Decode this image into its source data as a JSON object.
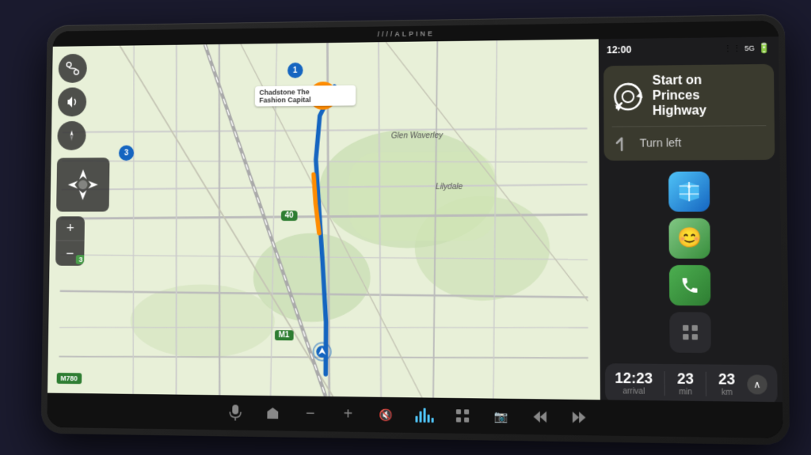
{
  "device": {
    "brand": "////ALPINE"
  },
  "status_bar": {
    "time": "12:00",
    "network": "5G",
    "battery_icon": "🔋"
  },
  "nav_card": {
    "main_instruction": "Start on\nPrinces\nHighway",
    "secondary_instruction": "Turn left"
  },
  "eta": {
    "arrival_time": "12:23",
    "arrival_label": "arrival",
    "duration_value": "23",
    "duration_label": "min",
    "distance_value": "23",
    "distance_label": "km"
  },
  "map": {
    "destination_name": "Chadstone The\nFashion Capital",
    "glen_waverley": "Glen Waverley",
    "lilydale": "Lilydale",
    "m780_label": "M780",
    "road_3": "3",
    "road_1": "1",
    "road_40": "40",
    "road_m1": "M1"
  },
  "app_icons": {
    "maps_label": "Maps",
    "waze_label": "Waze",
    "phone_label": "Phone",
    "grid_label": "Grid"
  },
  "bottom_bar": {
    "icons": [
      "🔇",
      "➕",
      "🚫",
      "🎵",
      "⋮⋮⋮",
      "📷",
      "⏮",
      "⏭"
    ]
  },
  "map_controls": {
    "route_btn": "↗",
    "volume_btn": "🔊",
    "compass_btn": "✦",
    "pan_btn": "✛",
    "zoom_in": "+",
    "zoom_out": "−",
    "zoom_level": "3"
  }
}
